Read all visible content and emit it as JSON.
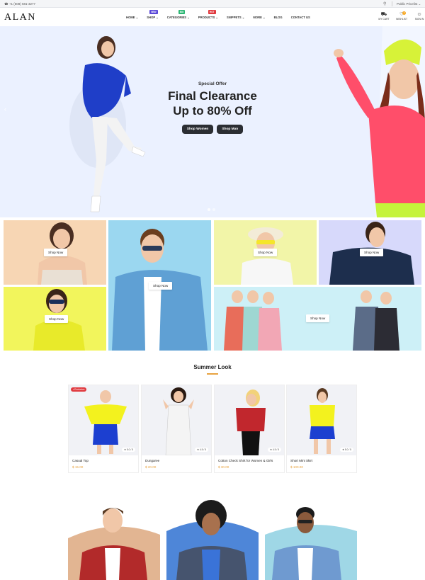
{
  "topbar": {
    "phone": "+1 (608) 681-3277",
    "pricelist": "Public Pricelist"
  },
  "header": {
    "logo": "ALAN",
    "nav": [
      {
        "label": "HOME ⌄",
        "badge": ""
      },
      {
        "label": "SHOP ⌄",
        "badge": "NEW",
        "badge_color": "#5a49d8"
      },
      {
        "label": "CATEGORIES ⌄",
        "badge": "BIG",
        "badge_color": "#2bb673"
      },
      {
        "label": "PRODUCTS ⌄",
        "badge": "HOT",
        "badge_color": "#e0393e"
      },
      {
        "label": "SNIPPETS ⌄",
        "badge": ""
      },
      {
        "label": "MORE ⌄",
        "badge": ""
      },
      {
        "label": "BLOG",
        "badge": ""
      },
      {
        "label": "CONTACT US",
        "badge": ""
      }
    ],
    "icons": [
      {
        "icon": "cart-icon",
        "glyph": "🛒",
        "label": "MY CART",
        "count": ""
      },
      {
        "icon": "heart-icon",
        "glyph": "♡",
        "label": "WISHLIST",
        "count": "0"
      },
      {
        "icon": "user-icon",
        "glyph": "👤",
        "label": "SIGN IN",
        "count": ""
      }
    ]
  },
  "hero": {
    "special": "Special Offer",
    "title_line1": "Final Clearance",
    "title_line2": "Up to 80% Off",
    "btn_women": "Shop Women",
    "btn_men": "Shop Man"
  },
  "categories": {
    "shop_now": "Shop Now"
  },
  "summer": {
    "title": "Summer Look",
    "exclusive": "• Exclusive",
    "products": [
      {
        "name": "Casual Top",
        "price": "$ 15.00",
        "rating": "★ 5.0 / 5"
      },
      {
        "name": "Dungaree",
        "price": "$ 20.00",
        "rating": "★ 4.5 / 5"
      },
      {
        "name": "Cotton Check Shirt for Women & Girls",
        "price": "$ 30.00",
        "rating": "★ 4.5 / 5"
      },
      {
        "name": "Short Mini Skirt",
        "price": "$ 100.00",
        "rating": "★ 5.0 / 5"
      }
    ]
  },
  "colors": {
    "accent": "#e8a340",
    "dark_button": "#2b2e33",
    "hero_bg": "#ebf1ff"
  }
}
